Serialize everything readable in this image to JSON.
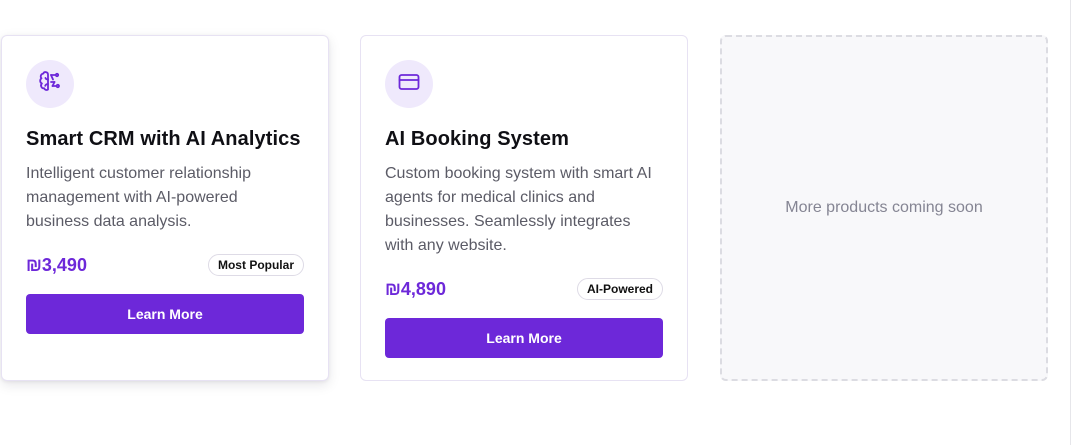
{
  "products": [
    {
      "icon": "brain-icon",
      "title": "Smart CRM with AI Analytics",
      "description": "Intelligent customer relationship management with AI-powered business data analysis.",
      "price": "₪3,490",
      "badge": "Most Popular",
      "button_label": "Learn More"
    },
    {
      "icon": "credit-card-icon",
      "title": "AI Booking System",
      "description": "Custom booking system with smart AI agents for medical clinics and businesses. Seamlessly integrates with any website.",
      "price": "₪4,890",
      "badge": "AI-Powered",
      "button_label": "Learn More"
    }
  ],
  "placeholder": {
    "text": "More products coming soon"
  },
  "colors": {
    "accent": "#6d28d9",
    "icon_bg": "#efe9fc",
    "card_border": "#e7e2f3"
  }
}
